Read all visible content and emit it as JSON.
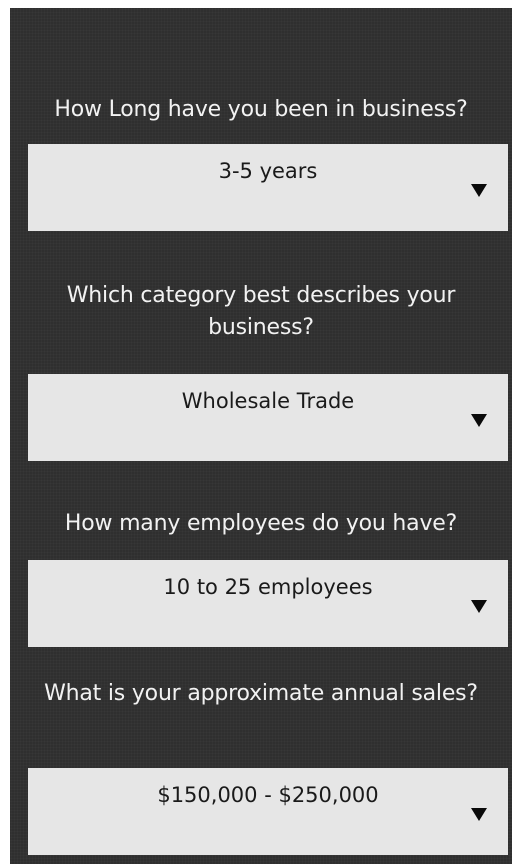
{
  "form": {
    "questions": [
      {
        "label": "How Long have you been in business?",
        "selected": "3-5 years"
      },
      {
        "label": "Which category best describes your business?",
        "selected": "Wholesale Trade"
      },
      {
        "label": "How many employees do you have?",
        "selected": "10 to 25 employees"
      },
      {
        "label": "What is your approximate annual sales?",
        "selected": "$150,000 - $250,000"
      }
    ],
    "dropdown_icon": "triangle-down-icon"
  },
  "colors": {
    "background": "#2f2f2f",
    "text": "#f2f2f2",
    "select_background": "#e6e6e6",
    "select_text": "#1a1a1a"
  }
}
